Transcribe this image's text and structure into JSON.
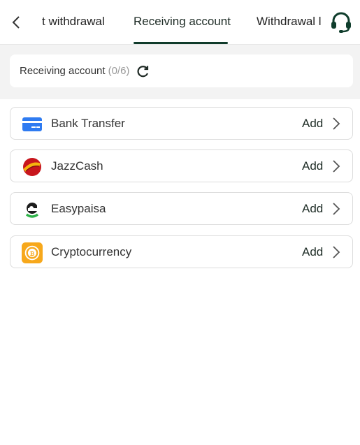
{
  "header": {
    "tabs": [
      {
        "label": "t withdrawal"
      },
      {
        "label": "Receiving account"
      },
      {
        "label": "Withdrawal l"
      }
    ],
    "active_tab": 1,
    "accent_color": "#103b2b"
  },
  "summary": {
    "label": "Receiving account",
    "count": "(0/6)"
  },
  "methods": [
    {
      "name": "Bank Transfer",
      "action": "Add",
      "icon": "bank-card-icon"
    },
    {
      "name": "JazzCash",
      "action": "Add",
      "icon": "jazzcash-logo-icon"
    },
    {
      "name": "Easypaisa",
      "action": "Add",
      "icon": "easypaisa-logo-icon"
    },
    {
      "name": "Cryptocurrency",
      "action": "Add",
      "icon": "bitcoin-icon"
    }
  ]
}
